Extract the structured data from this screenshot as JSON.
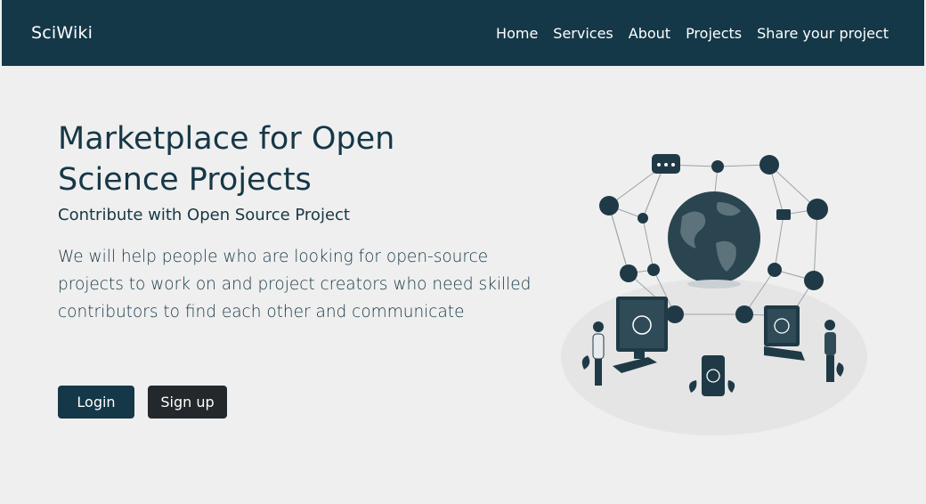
{
  "navbar": {
    "brand": "SciWiki",
    "links": [
      "Home",
      "Services",
      "About",
      "Projects",
      "Share your project"
    ]
  },
  "hero": {
    "title": "Marketplace for Open Science Projects",
    "subtitle": "Contribute with Open Source Project",
    "description": "We will help people who are looking for open-source projects to work on and project creators who need skilled contributors to find each other and communicate"
  },
  "buttons": {
    "login": "Login",
    "signup": "Sign up"
  },
  "colors": {
    "primary": "#143848",
    "dark_button": "#23282c",
    "background": "#efefef"
  },
  "illustration": {
    "icons": [
      "chat-icon",
      "location-pin-icon",
      "facebook-icon",
      "music-icon",
      "heart-icon",
      "mail-icon",
      "user-icon",
      "dollar-icon",
      "twitter-icon",
      "instagram-icon",
      "image-icon",
      "play-icon",
      "thumbs-up-icon",
      "globe-icon"
    ]
  }
}
